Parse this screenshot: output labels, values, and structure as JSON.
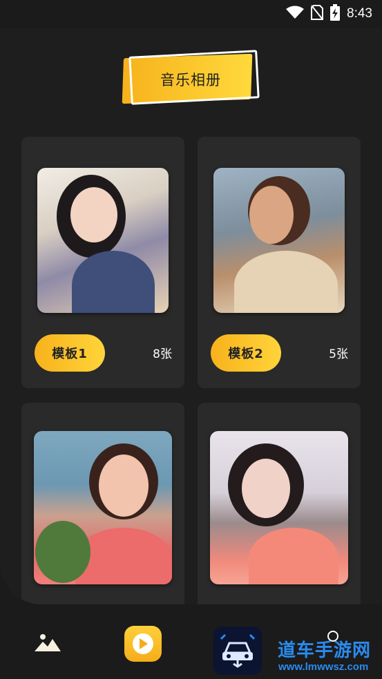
{
  "status_bar": {
    "time": "8:43",
    "icons": [
      "wifi-icon",
      "no-sim-icon",
      "battery-charging-icon"
    ]
  },
  "header": {
    "title": "音乐相册"
  },
  "albums": [
    {
      "label": "模板1",
      "count": "8张",
      "image": "portrait-girl-smiling"
    },
    {
      "label": "模板2",
      "count": "5张",
      "image": "portrait-woman-gold-paint"
    },
    {
      "label": "",
      "count": "",
      "image": "portrait-girl-flowers"
    },
    {
      "label": "",
      "count": "",
      "image": "portrait-girl-pink-top"
    }
  ],
  "bottom_nav": {
    "items": [
      "photo-gallery-icon",
      "play-icon"
    ]
  },
  "watermark": {
    "text": "道车手游网",
    "url": "www.lmwwsz.com"
  },
  "colors": {
    "accent_start": "#f7b21c",
    "accent_end": "#ffd43a",
    "background": "#1b1b1b",
    "card": "#2a2a2a",
    "watermark_blue": "#2a8bf0"
  }
}
